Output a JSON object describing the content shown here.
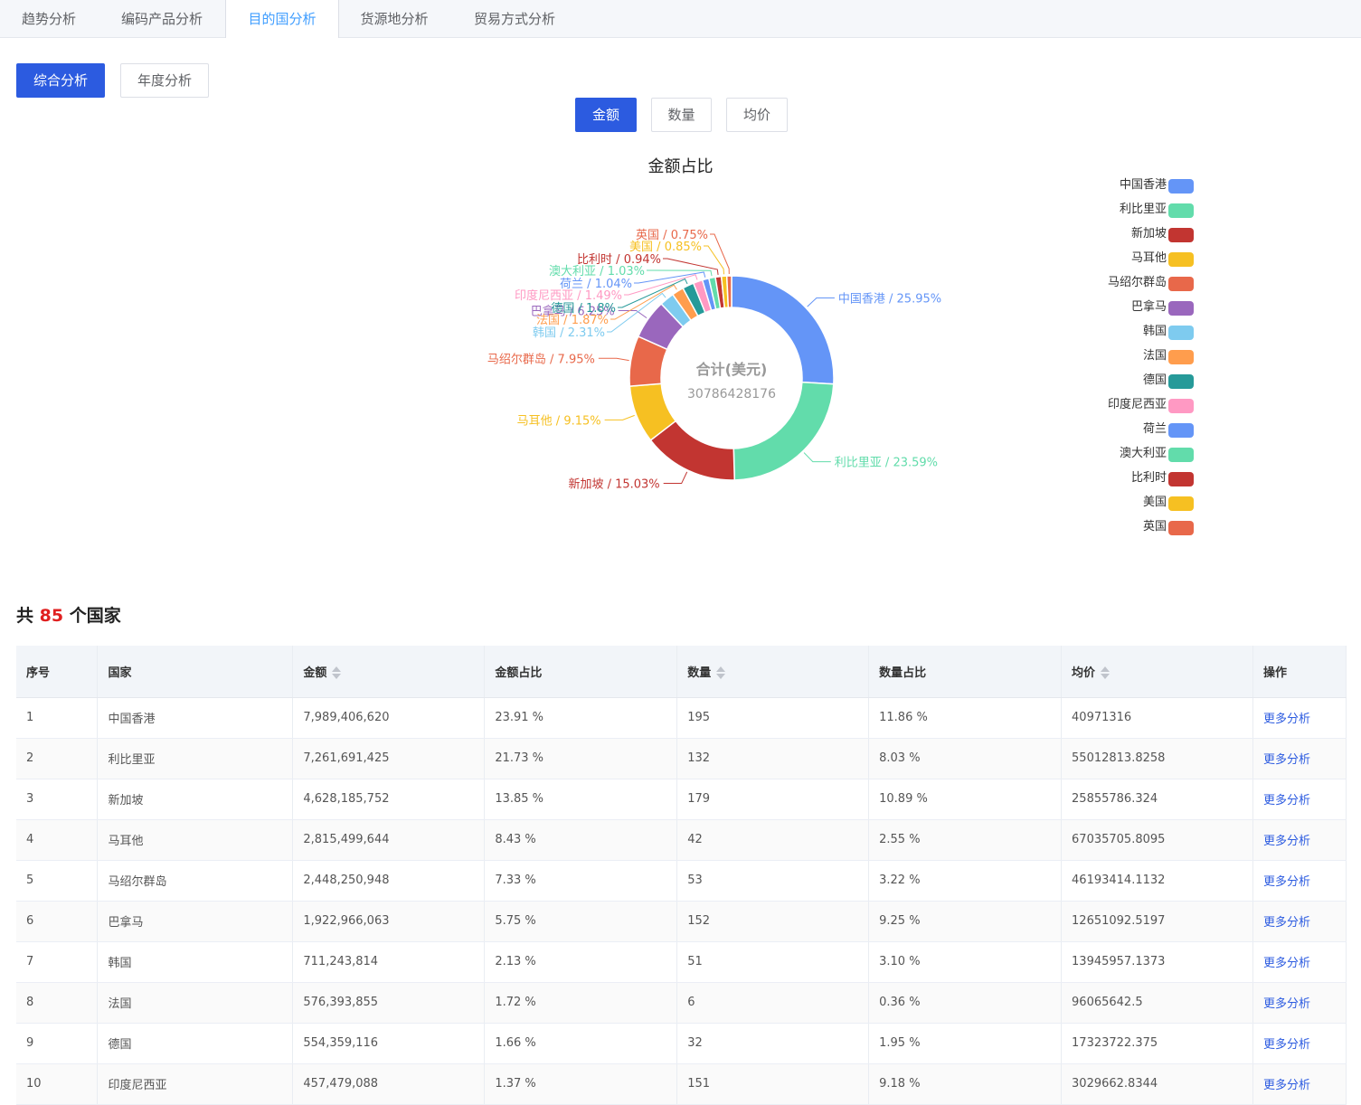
{
  "tabs": [
    {
      "label": "趋势分析"
    },
    {
      "label": "编码产品分析"
    },
    {
      "label": "目的国分析"
    },
    {
      "label": "货源地分析"
    },
    {
      "label": "贸易方式分析"
    }
  ],
  "view_buttons": {
    "overview": "综合分析",
    "annual": "年度分析"
  },
  "metric_buttons": {
    "amount": "金额",
    "quantity": "数量",
    "avg": "均价"
  },
  "colors": {
    "primary": "#2c5be0",
    "active_tab": "#409eff",
    "highlight": "#e02020"
  },
  "chart_data": {
    "type": "pie",
    "title": "金额占比",
    "center_label": "合计(美元)",
    "center_value": "30786428176",
    "legend_position": "right",
    "slices": [
      {
        "name": "中国香港",
        "value": 25.95,
        "label": "中国香港 / 25.95%",
        "color": "#6495f7"
      },
      {
        "name": "利比里亚",
        "value": 23.59,
        "label": "利比里亚 / 23.59%",
        "color": "#62dcab"
      },
      {
        "name": "新加坡",
        "value": 15.03,
        "label": "新加坡 / 15.03%",
        "color": "#c23531"
      },
      {
        "name": "马耳他",
        "value": 9.15,
        "label": "马耳他 / 9.15%",
        "color": "#f6c022"
      },
      {
        "name": "马绍尔群岛",
        "value": 7.95,
        "label": "马绍尔群岛 / 7.95%",
        "color": "#e8684a"
      },
      {
        "name": "巴拿马",
        "value": 6.25,
        "label": "巴拿马 / 6.25%",
        "color": "#9a67bd"
      },
      {
        "name": "韩国",
        "value": 2.31,
        "label": "韩国 / 2.31%",
        "color": "#7ecbef"
      },
      {
        "name": "法国",
        "value": 1.87,
        "label": "法国 / 1.87%",
        "color": "#ff9d4d"
      },
      {
        "name": "德国",
        "value": 1.8,
        "label": "德国 / 1.8%",
        "color": "#269a99"
      },
      {
        "name": "印度尼西亚",
        "value": 1.49,
        "label": "印度尼西亚 / 1.49%",
        "color": "#ff99c3"
      },
      {
        "name": "荷兰",
        "value": 1.04,
        "label": "荷兰 / 1.04%",
        "color": "#6495f7"
      },
      {
        "name": "澳大利亚",
        "value": 1.03,
        "label": "澳大利亚 / 1.03%",
        "color": "#62dcab"
      },
      {
        "name": "比利时",
        "value": 0.94,
        "label": "比利时 / 0.94%",
        "color": "#c23531"
      },
      {
        "name": "美国",
        "value": 0.85,
        "label": "美国 / 0.85%",
        "color": "#f6c022"
      },
      {
        "name": "英国",
        "value": 0.75,
        "label": "英国 / 0.75%",
        "color": "#e8684a"
      }
    ]
  },
  "summary": {
    "prefix": "共",
    "count": "85",
    "suffix": "个国家"
  },
  "table": {
    "headers": [
      "序号",
      "国家",
      "金额",
      "金额占比",
      "数量",
      "数量占比",
      "均价",
      "操作"
    ],
    "rows": [
      [
        "1",
        "中国香港",
        "7,989,406,620",
        "23.91 %",
        "195",
        "11.86 %",
        "40971316",
        "更多分析"
      ],
      [
        "2",
        "利比里亚",
        "7,261,691,425",
        "21.73 %",
        "132",
        "8.03 %",
        "55012813.8258",
        "更多分析"
      ],
      [
        "3",
        "新加坡",
        "4,628,185,752",
        "13.85 %",
        "179",
        "10.89 %",
        "25855786.324",
        "更多分析"
      ],
      [
        "4",
        "马耳他",
        "2,815,499,644",
        "8.43 %",
        "42",
        "2.55 %",
        "67035705.8095",
        "更多分析"
      ],
      [
        "5",
        "马绍尔群岛",
        "2,448,250,948",
        "7.33 %",
        "53",
        "3.22 %",
        "46193414.1132",
        "更多分析"
      ],
      [
        "6",
        "巴拿马",
        "1,922,966,063",
        "5.75 %",
        "152",
        "9.25 %",
        "12651092.5197",
        "更多分析"
      ],
      [
        "7",
        "韩国",
        "711,243,814",
        "2.13 %",
        "51",
        "3.10 %",
        "13945957.1373",
        "更多分析"
      ],
      [
        "8",
        "法国",
        "576,393,855",
        "1.72 %",
        "6",
        "0.36 %",
        "96065642.5",
        "更多分析"
      ],
      [
        "9",
        "德国",
        "554,359,116",
        "1.66 %",
        "32",
        "1.95 %",
        "17323722.375",
        "更多分析"
      ],
      [
        "10",
        "印度尼西亚",
        "457,479,088",
        "1.37 %",
        "151",
        "9.18 %",
        "3029662.8344",
        "更多分析"
      ]
    ]
  }
}
